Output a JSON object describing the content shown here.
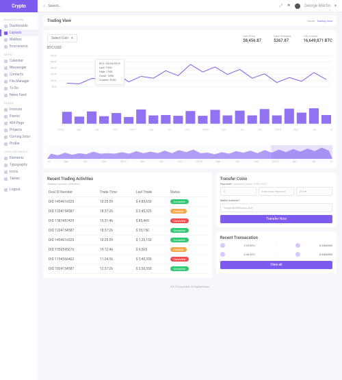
{
  "brand": "Crypto",
  "search": {
    "placeholder": "Search..."
  },
  "user": {
    "name": "George Martin"
  },
  "sidebar": {
    "sections": [
      {
        "title": "NAVIGATIONS",
        "items": [
          "Dashboards",
          "Layouts",
          "Mailbox",
          "Ecommerce"
        ]
      },
      {
        "title": "APPS",
        "items": [
          "Calendar",
          "Messenger",
          "Contacts",
          "File Manager",
          "To Do",
          "News Feed"
        ]
      },
      {
        "title": "PAGES",
        "items": [
          "Invoices",
          "Events",
          "404 Page",
          "Projects",
          "Coming Soon",
          "Profile"
        ]
      },
      {
        "title": "USER INTERFACE",
        "items": [
          "Elements",
          "Typography",
          "Icons",
          "Tables"
        ]
      }
    ],
    "logout": "Logout",
    "active": "Layouts"
  },
  "page": {
    "title": "Trading View",
    "crumb_home": "Home",
    "crumb_current": "Trading View"
  },
  "chart": {
    "select_label": "Select Coin",
    "pair": "BTC/USD",
    "stats": [
      {
        "label": "Last Price",
        "value": "$8,456.87"
      },
      {
        "label": "Daily Changes",
        "value": "$267.87"
      },
      {
        "label": "24h Volume",
        "value": "16,649,871 BTC"
      }
    ],
    "tooltip": {
      "head": "BTC: 20/04/2019",
      "last": "Last: 1920",
      "high": "High: 1920",
      "close": "Close: 1850",
      "volume": "Volume: 5740"
    }
  },
  "chart_data": {
    "type": "combo",
    "line_y_axis": [
      1000,
      2000,
      3000,
      4000,
      5000,
      6000
    ],
    "line_values": [
      1600,
      1500,
      2350,
      2300,
      3200,
      1800,
      2700,
      2400,
      3600,
      2800,
      4600,
      3400,
      4200,
      3000,
      3800,
      2400,
      3100,
      1700,
      2500,
      1900,
      3300,
      2200
    ],
    "bar_values": [
      3000,
      1800,
      3100,
      1900,
      2700,
      1700,
      3600,
      2100,
      2200,
      2000,
      3200,
      2000,
      3500,
      2100,
      3300,
      2100,
      3700,
      2100,
      3800,
      2800,
      3900,
      2200
    ],
    "range_values": [
      10,
      7,
      12,
      8,
      11,
      9,
      14,
      10,
      11,
      10,
      13,
      10,
      15,
      11,
      14,
      11,
      16,
      11,
      17,
      13,
      18,
      11,
      12,
      9,
      13,
      10,
      15,
      12,
      16,
      11,
      17,
      12,
      18,
      13,
      19,
      14,
      20,
      15,
      22,
      16
    ],
    "x_ticks": [
      "2016",
      "Apr",
      "Jul",
      "Oct",
      "2017",
      "Apr",
      "Jul",
      "Oct",
      "2018",
      "Apr",
      "Jul",
      "Oct",
      "2019",
      "Apr",
      "Jul",
      "Oct"
    ],
    "range_ticks": [
      "2016",
      "Apr",
      "Jul",
      "Oct",
      "2017",
      "Apr",
      "Jul",
      "Oct",
      "2018",
      "Apr",
      "Jul",
      "Oct",
      "2019",
      "Apr",
      "Jul",
      "Oct"
    ]
  },
  "activities": {
    "title": "Recent Trading Activities",
    "subtitle": "Trading Currency Activities",
    "cols": [
      "Deal ID Number",
      "Trade Time",
      "Last Trade",
      "Status"
    ],
    "rows": [
      {
        "id": "DID 1454616520",
        "time": "10:25:59",
        "amt": "$ 4,85,650",
        "status": "Complete",
        "cls": "b-green"
      },
      {
        "id": "DID 1204154587",
        "time": "18:37:26",
        "amt": "$ 2,45,325",
        "status": "Pending",
        "cls": "b-orange"
      },
      {
        "id": "DID 1387457429",
        "time": "15:31:46",
        "amt": "$ 85,469",
        "status": "Cancelled",
        "cls": "b-red"
      },
      {
        "id": "DID 1204154587",
        "time": "18:37:26",
        "amt": "$ 35,150",
        "status": "Complete",
        "cls": "b-green"
      },
      {
        "id": "DID 1454616520",
        "time": "10:25:59",
        "amt": "$ 1,25,150",
        "status": "Complete",
        "cls": "b-green"
      },
      {
        "id": "DID 1350545676",
        "time": "19:12:46",
        "amt": "$ 6,565",
        "status": "Pending",
        "cls": "b-orange"
      },
      {
        "id": "DID 1194366462",
        "time": "11:24:36",
        "amt": "$ 5,45,350",
        "status": "Cancelled",
        "cls": "b-red"
      },
      {
        "id": "DID 1824154587",
        "time": "12:37:26",
        "amt": "$ 2,50,350",
        "status": "Complete",
        "cls": "b-green"
      }
    ]
  },
  "transfer": {
    "title": "Transfer Coins",
    "payment_label": "Payment*",
    "payment_hint": "Minimum Value \"0.001 BTC\"",
    "amount_placeholder": "Enter your Payment",
    "currency": "BTC",
    "wallet_label": "Wallet Address*",
    "wallet_placeholder": "WqrRfd25WctGaLJKH",
    "button": "Transfer Now"
  },
  "transactions": {
    "title": "Recent Transacation",
    "rows": [
      {
        "from": "2.25 BTC",
        "to": "0.6563565"
      },
      {
        "from": "0.36 BTC",
        "to": "0.6563565"
      }
    ],
    "button": "View all"
  },
  "footer": "2019 Copyrights © DigitalHeaps"
}
